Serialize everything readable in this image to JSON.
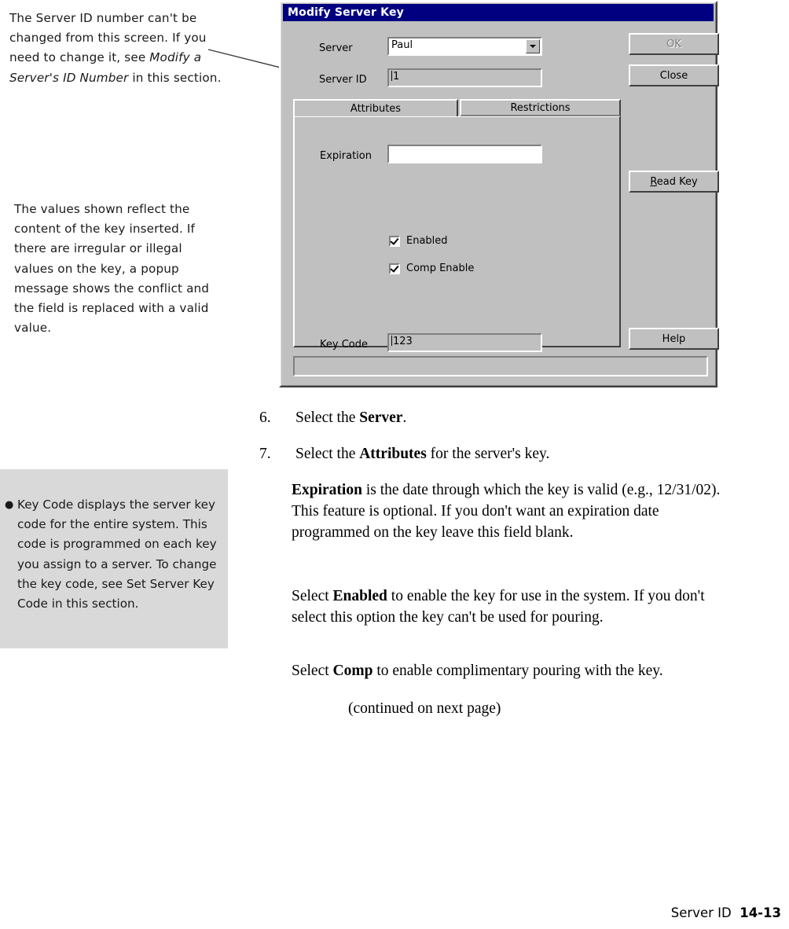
{
  "margin_notes": {
    "server_id_note": {
      "part1": "The Server ID number can't be changed from this screen. If you need to change it, see ",
      "italic": "Modify a Server's ID Number",
      "part2": " in this section."
    },
    "values_note": {
      "text": "The values shown reflect the content of the key inserted. If there are irregular or illegal values on the key, a popup message shows the conflict and the field is replaced with a valid value."
    },
    "key_code_note": {
      "bullet": "●",
      "part1": "Key Code displays the server key code for the entire system. This code is programmed on each key you assign to a server. To change the key code, see ",
      "italic": "Set Server Key Code",
      "part2": " in this section."
    }
  },
  "dialog": {
    "title": "Modify Server Key",
    "fields": {
      "server_label": "Server",
      "server_value": "Paul",
      "server_id_label": "Server ID",
      "server_id_value": "1",
      "expiration_label": "Expiration",
      "expiration_value": "",
      "key_code_label": "Key Code",
      "key_code_value": "123",
      "status_value": ""
    },
    "tabs": [
      {
        "label": "Attributes",
        "active": true
      },
      {
        "label": "Restrictions",
        "active": false
      }
    ],
    "checkboxes": [
      {
        "label": "Enabled",
        "checked": true
      },
      {
        "label": "Comp Enable",
        "checked": true
      }
    ],
    "buttons": {
      "ok": "OK",
      "close": "Close",
      "read_key_accel": "R",
      "read_key_rest": "ead Key",
      "help": "Help"
    },
    "colors": {
      "titlebar": "#000080",
      "face": "#c0c0c0",
      "shadow": "#808080",
      "dark": "#404040",
      "light": "#ffffff",
      "disabled_text": "#808080"
    }
  },
  "body": {
    "step6": {
      "number": "6.",
      "pre": "Select the ",
      "bold": "Server",
      "post": "."
    },
    "step7": {
      "number": "7.",
      "pre": "Select the ",
      "bold": "Attributes",
      "post": " for the server's key."
    },
    "para_expiration": {
      "bold": "Expiration",
      "text": " is the date through which the key is valid (e.g., 12/31/02). This feature is optional. If you don't want an expiration date programmed on the key leave this field blank."
    },
    "para_enabled": {
      "pre": "Select ",
      "bold": "Enabled",
      "post": " to enable the key for use in the system. If you don't select this option the key can't be used for pouring."
    },
    "para_comp": {
      "pre": "Select ",
      "bold": "Comp",
      "post": " to enable complimentary pouring with the key."
    },
    "continued": "(continued on next page)"
  },
  "footer": {
    "section": "Server ID",
    "page": "14-13"
  }
}
